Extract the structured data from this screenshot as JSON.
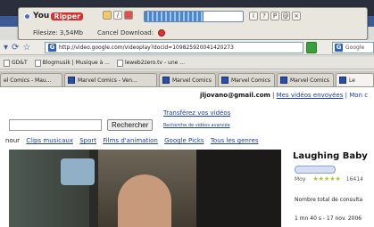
{
  "ripper": {
    "brand_you": "You",
    "brand_ripper": "Ripper",
    "filesize": "Filesize: 3,54Mb",
    "cancel": "Cancel Download:",
    "progress": 0.6,
    "buttons": [
      "i",
      "?",
      "P",
      "@",
      "×"
    ]
  },
  "nav": {
    "url": "http://video.google.com/videoplay?docid=109825920041420273",
    "search_engine": "Google"
  },
  "bookmarks": [
    "GD&T",
    "Blogmusik | Musique à ...",
    "leweb2zero.tv - une ..."
  ],
  "tabs": [
    {
      "label": "el Comics - Mau..."
    },
    {
      "label": "Marvel Comics - Ven..."
    },
    {
      "label": "Marvel Comics"
    },
    {
      "label": "Marvel Comics"
    },
    {
      "label": "Marvel Comics"
    },
    {
      "label": "Le"
    }
  ],
  "account": {
    "email": "jljovano@gmail.com",
    "sep": " | ",
    "sent": "Mes vidéos envoyées",
    "more": " | Mon c"
  },
  "search": {
    "transfer_link": "Transférez vos vidéos",
    "button": "Rechercher",
    "advanced": "Recherche de vidéos avancée"
  },
  "categories": [
    "nour",
    "Clips musicaux",
    "Sport",
    "Films d'animation",
    "Google Picks",
    "Tous les genres"
  ],
  "video": {
    "title": "Laughing Baby",
    "author": "Moy",
    "views": "16414",
    "total_label": "Nombre total de consulta",
    "date": "1 mn 40 s - 17 nov. 2006"
  }
}
